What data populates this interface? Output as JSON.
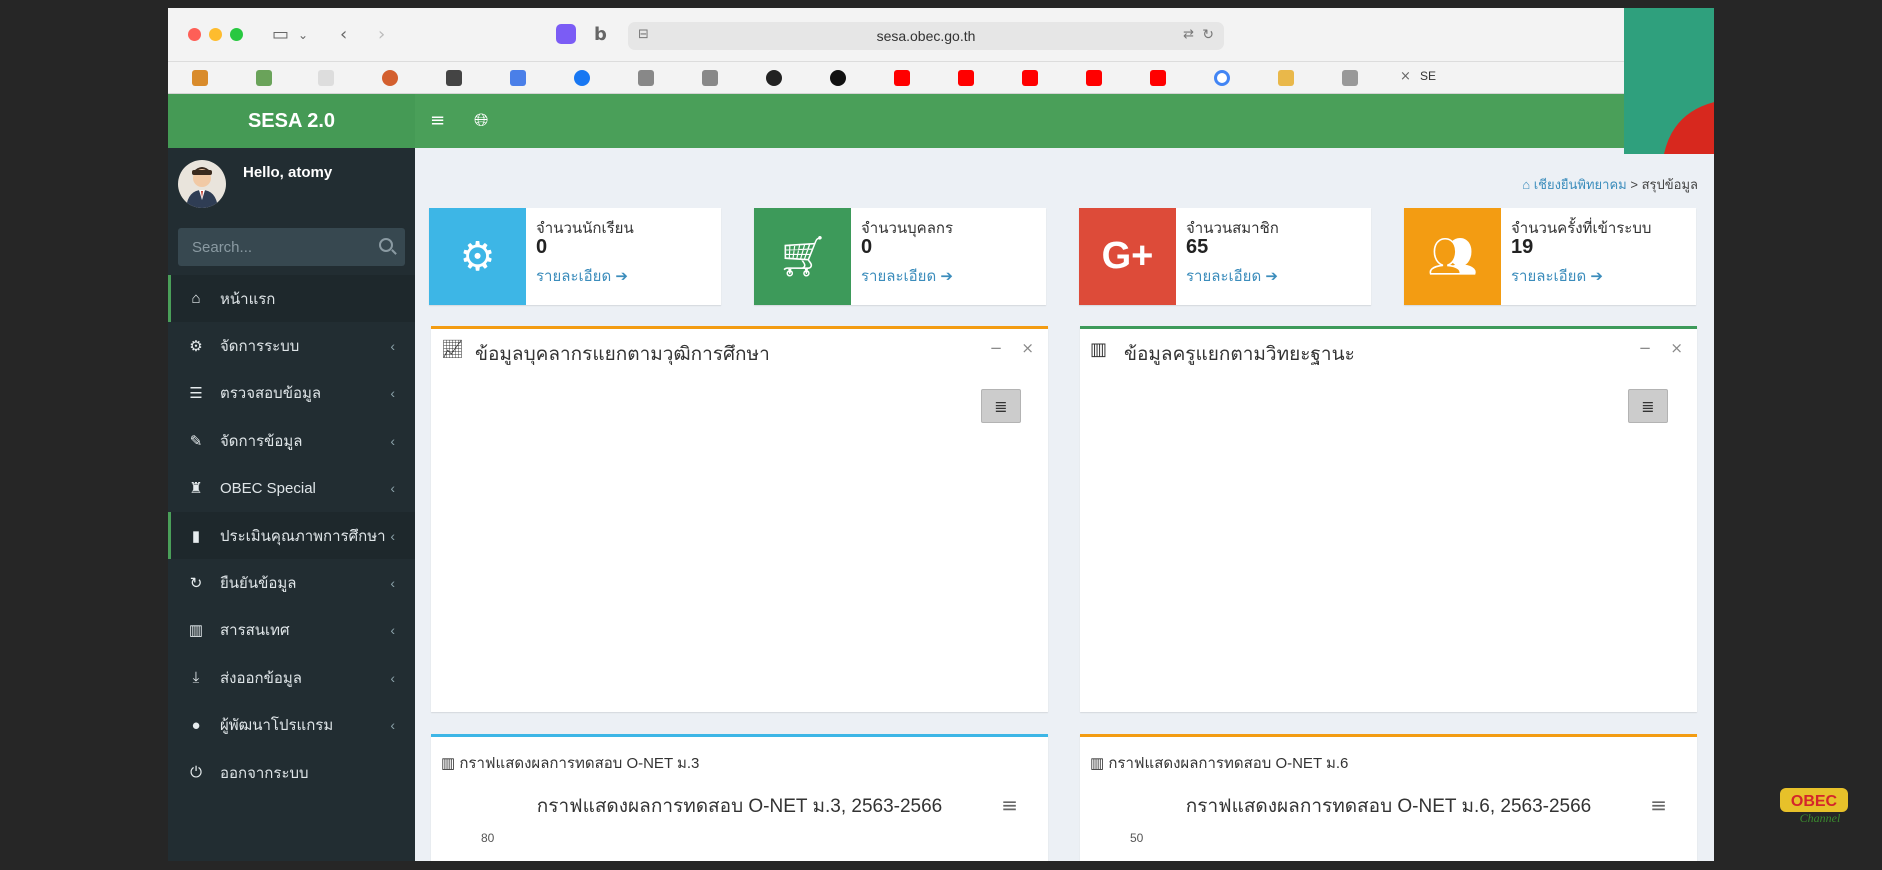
{
  "browser": {
    "url": "sesa.obec.go.th",
    "tab_label": "SE"
  },
  "app": {
    "logo": "SESA 2.0"
  },
  "user": {
    "greeting": "Hello, atomy"
  },
  "search": {
    "placeholder": "Search..."
  },
  "sidebar": {
    "items": [
      {
        "label": "หน้าแรก",
        "icon": "home-icon"
      },
      {
        "label": "จัดการระบบ",
        "icon": "gear-icon"
      },
      {
        "label": "ตรวจสอบข้อมูล",
        "icon": "list-icon"
      },
      {
        "label": "จัดการข้อมูล",
        "icon": "edit-icon"
      },
      {
        "label": "OBEC Special",
        "icon": "chess-icon"
      },
      {
        "label": "ประเมินคุณภาพการศึกษา",
        "icon": "bar-chart-icon"
      },
      {
        "label": "ยืนยันข้อมูล",
        "icon": "refresh-icon"
      },
      {
        "label": "สารสนเทศ",
        "icon": "area-chart-icon"
      },
      {
        "label": "ส่งออกข้อมูล",
        "icon": "download-icon"
      },
      {
        "label": "ผู้พัฒนาโปรแกรม",
        "icon": "user-icon"
      },
      {
        "label": "ออกจากระบบ",
        "icon": "power-icon"
      }
    ]
  },
  "breadcrumb": {
    "home": "เชียงยืนพิทยาคม",
    "separator": ">",
    "current": "สรุปข้อมูล"
  },
  "stats": [
    {
      "label": "จำนวนนักเรียน",
      "value": "0",
      "link": "รายละเอียด",
      "color": "#3db6e6",
      "icon": "gear-icon"
    },
    {
      "label": "จำนวนบุคลกร",
      "value": "0",
      "link": "รายละเอียด",
      "color": "#3d9a5a",
      "icon": "cart-icon"
    },
    {
      "label": "จำนวนสมาชิก",
      "value": "65",
      "link": "รายละเอียด",
      "color": "#dd4b39",
      "icon": "google-plus-icon"
    },
    {
      "label": "จำนวนครั้งที่เข้าระบบ",
      "value": "19",
      "link": "รายละเอียด",
      "color": "#f39c12",
      "icon": "users-icon"
    }
  ],
  "panels": {
    "personnel": {
      "title": "ข้อมูลบุคลากรแยกตามวุฒิการศึกษา",
      "accent": "#f39c12"
    },
    "teachers": {
      "title": "ข้อมูลครูแยกตามวิทยะฐานะ",
      "accent": "#3d9a5a"
    },
    "onet3": {
      "header": "กราฟแสดงผลการทดสอบ O-NET ม.3",
      "title": "กราฟแสดงผลการทดสอบ O-NET ม.3, 2563-2566",
      "ytick": "80",
      "accent": "#3db6e6"
    },
    "onet6": {
      "header": "กราฟแสดงผลการทดสอบ O-NET ม.6",
      "title": "กราฟแสดงผลการทดสอบ O-NET ม.6, 2563-2566",
      "ytick": "50",
      "accent": "#f39c12"
    }
  },
  "overlay": {
    "obec_logo_text": "OBEC",
    "obec_logo_sub": "Channel"
  }
}
